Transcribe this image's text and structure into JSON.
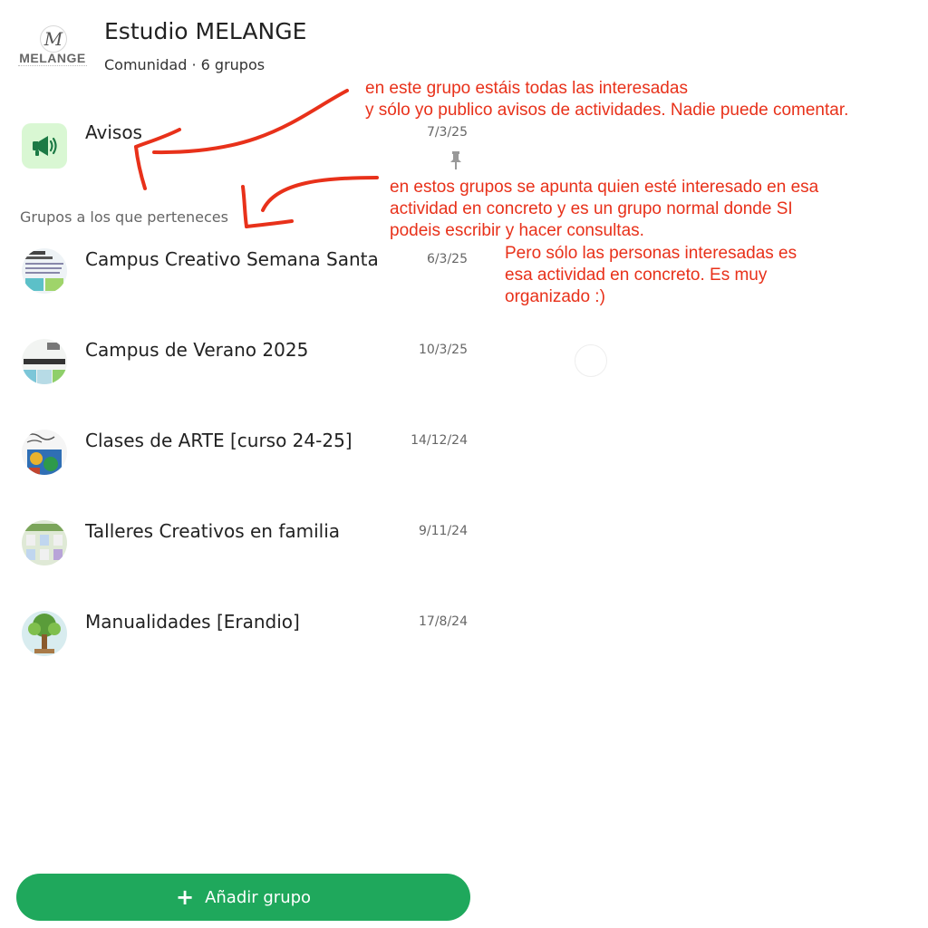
{
  "community": {
    "logo_text": "MELANGE",
    "logo_initial": "M",
    "title": "Estudio MELANGE",
    "subtitle": "Comunidad · 6 grupos"
  },
  "announcements": {
    "name": "Avisos",
    "date": "7/3/25",
    "icon": "megaphone-icon",
    "pinned": true
  },
  "section_label": "Grupos a los que perteneces",
  "groups": [
    {
      "name": "Campus Creativo Semana Santa",
      "date": "6/3/25"
    },
    {
      "name": "Campus de Verano 2025",
      "date": "10/3/25"
    },
    {
      "name": "Clases de ARTE [curso 24-25]",
      "date": "14/12/24"
    },
    {
      "name": "Talleres Creativos en familia",
      "date": "9/11/24"
    },
    {
      "name": "Manualidades [Erandio]",
      "date": "17/8/24"
    }
  ],
  "add_button": {
    "label": "Añadir grupo",
    "icon": "plus-icon"
  },
  "annotations": {
    "note1": [
      "en este grupo estáis todas las interesadas",
      "y sólo yo publico avisos de actividades. Nadie puede comentar."
    ],
    "note2": [
      "en estos grupos se apunta quien esté interesado en esa",
      "actividad en concreto y es un grupo normal donde SI",
      "podeis escribir y hacer consultas."
    ],
    "note3": [
      "Pero sólo las personas interesadas es",
      "esa actividad en concreto. Es muy",
      "organizado :)"
    ]
  },
  "colors": {
    "accent_green": "#1fa85c",
    "annotation_red": "#e8311a",
    "avisos_bg": "#d9f7d3",
    "megaphone": "#1c7a45"
  }
}
